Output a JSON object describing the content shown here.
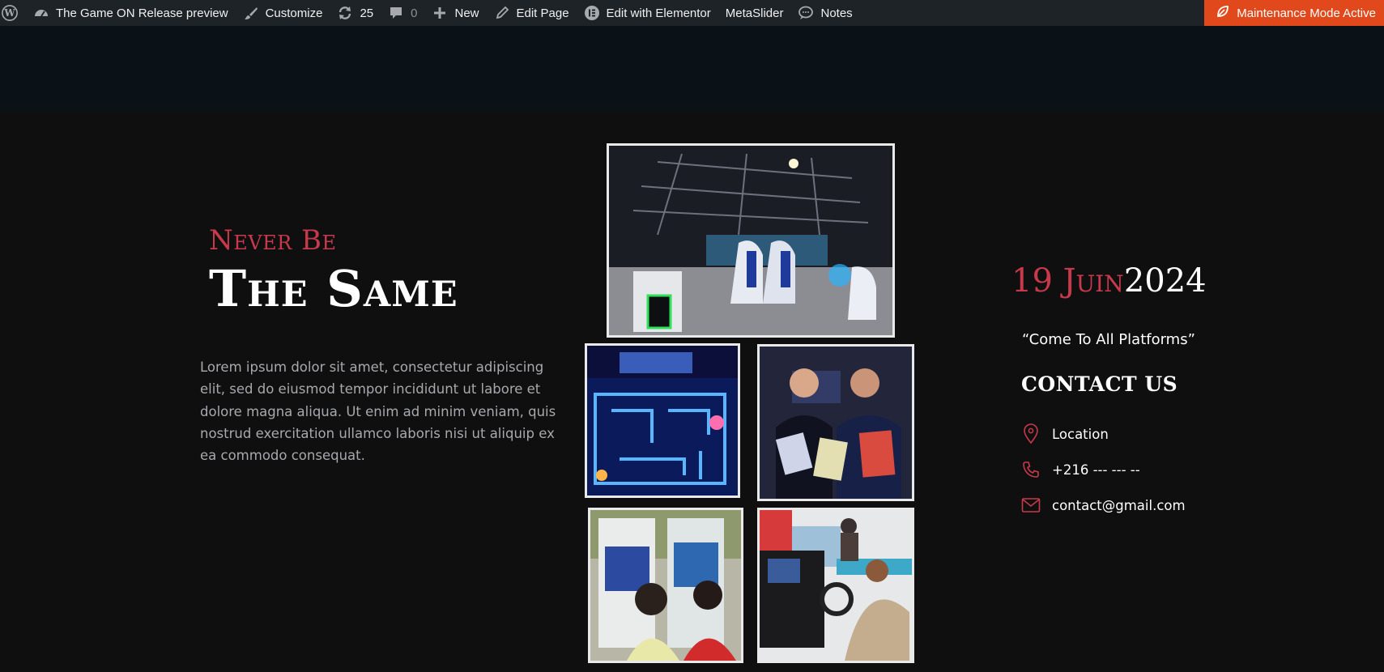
{
  "adminbar": {
    "site_title": "The Game ON Release preview",
    "customize": "Customize",
    "updates_count": "25",
    "comments_count": "0",
    "new": "New",
    "edit_page": "Edit Page",
    "edit_elementor": "Edit with Elementor",
    "metaslider": "MetaSlider",
    "notes": "Notes",
    "maintenance": "Maintenance Mode Active"
  },
  "hero": {
    "kicker": "Never Be",
    "headline": "The Same",
    "body": "Lorem ipsum dolor sit amet, consectetur adipiscing elit, sed do eiusmod tempor incididunt ut labore et dolore magna aliqua. Ut enim ad minim veniam, quis nostrud exercitation ullamco laboris nisi ut aliquip ex ea commodo consequat."
  },
  "event": {
    "date_day_month": "19 Juin",
    "date_year": "2024",
    "quote": "“Come To All Platforms”",
    "contact_title": "CONTACT US",
    "location": "Location",
    "phone": "+216 --- --- --",
    "email": "contact@gmail.com"
  },
  "colors": {
    "accent": "#c83a4b",
    "adminbar_bg": "#1d2327",
    "maintenance_bg": "#e1491c",
    "page_bg": "#0f0f10"
  }
}
